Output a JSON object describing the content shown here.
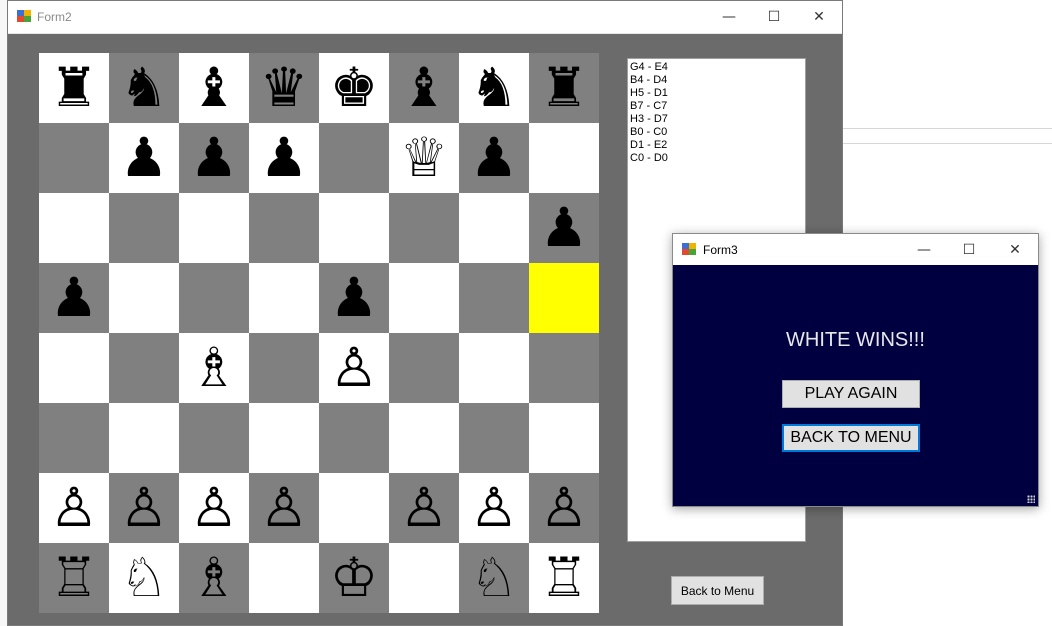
{
  "form2": {
    "title": "Form2",
    "controls": {
      "minimize": "—",
      "maximize": "☐",
      "close": "✕"
    },
    "board": {
      "highlight": {
        "row": 3,
        "col": 7
      },
      "ranks": [
        [
          "♜",
          "♞",
          "♝",
          "♛",
          "♚",
          "♝",
          "♞",
          "♜"
        ],
        [
          "",
          "♟",
          "♟",
          "♟",
          "",
          "♕",
          "♟",
          ""
        ],
        [
          "",
          "",
          "",
          "",
          "",
          "",
          "",
          "♟"
        ],
        [
          "♟",
          "",
          "",
          "",
          "♟",
          "",
          "",
          ""
        ],
        [
          "",
          "",
          "♗",
          "",
          "♙",
          "",
          "",
          ""
        ],
        [
          "",
          "",
          "",
          "",
          "",
          "",
          "",
          ""
        ],
        [
          "♙",
          "♙",
          "♙",
          "♙",
          "",
          "♙",
          "♙",
          "♙"
        ],
        [
          "♖",
          "♘",
          "♗",
          "",
          "♔",
          "",
          "♘",
          "♖"
        ]
      ]
    },
    "moves": [
      "G4 - E4",
      "B4 - D4",
      "H5 - D1",
      "B7 - C7",
      "H3 - D7",
      "B0 - C0",
      "D1 - E2",
      "C0 - D0"
    ],
    "back_to_menu_label": "Back to Menu"
  },
  "form3": {
    "title": "Form3",
    "controls": {
      "minimize": "—",
      "maximize": "☐",
      "close": "✕"
    },
    "result_text": "WHITE WINS!!!",
    "play_again_label": "PLAY AGAIN",
    "back_to_menu_label": "BACK TO MENU"
  },
  "colors": {
    "light_square": "#ffffff",
    "dark_square": "#808080",
    "highlight_square": "#ffff00",
    "form_background": "#6b6b6b",
    "dialog_background": "#000040"
  }
}
